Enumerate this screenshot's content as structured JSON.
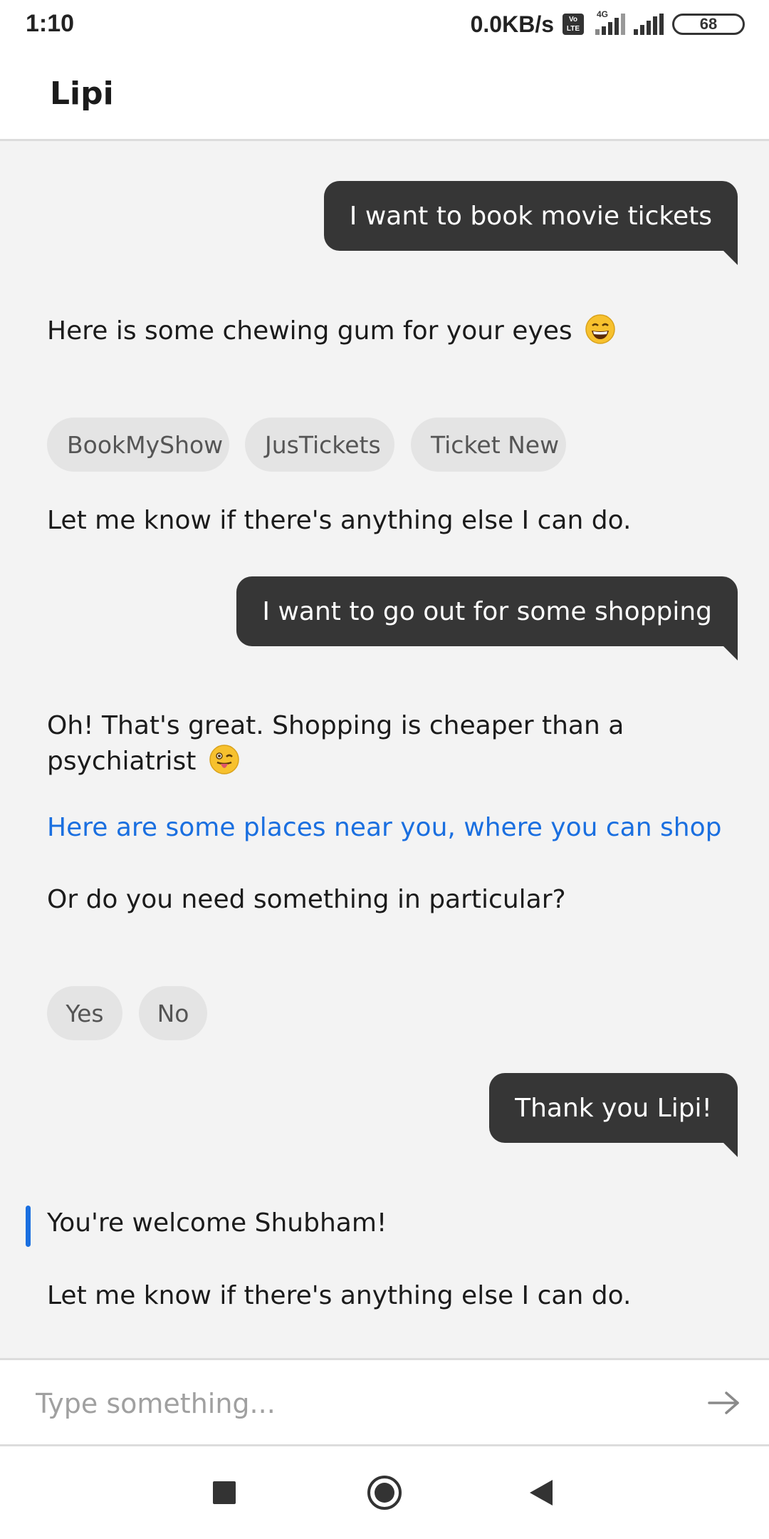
{
  "status_bar": {
    "time": "1:10",
    "net_speed": "0.0KB/s",
    "volte_top": "Vo",
    "volte_bottom": "LTE",
    "network_type": "4G",
    "battery": "68"
  },
  "app_bar": {
    "title": "Lipi"
  },
  "messages": [
    {
      "from": "user",
      "text": "I want to book movie tickets"
    },
    {
      "from": "bot",
      "text": "Here is some chewing gum for your eyes",
      "emoji_icon": "grinning-face-emoji"
    },
    {
      "from": "bot",
      "chips": [
        "BookMyShow",
        "JusTickets",
        "Ticket New"
      ]
    },
    {
      "from": "bot",
      "text": "Let me know if there's anything else I can do."
    },
    {
      "from": "user",
      "text": "I want to go out for some shopping"
    },
    {
      "from": "bot",
      "text_line1": "Oh! That's great. Shopping is cheaper than a",
      "text_line2": "psychiatrist",
      "emoji_icon": "winking-tongue-emoji"
    },
    {
      "from": "bot",
      "link_text": "Here are some places near you, where you can shop"
    },
    {
      "from": "bot",
      "text": "Or do you need something in particular?"
    },
    {
      "from": "bot",
      "chips": [
        "Yes",
        "No"
      ]
    },
    {
      "from": "user",
      "text": "Thank you Lipi!"
    },
    {
      "from": "bot",
      "text": "You're welcome Shubham!"
    },
    {
      "from": "bot",
      "text": "Let me know if there's anything else I can do."
    }
  ],
  "input": {
    "placeholder": "Type something...",
    "value": "",
    "send_icon": "arrow-right-icon"
  },
  "nav_bar": {
    "icons": [
      "recents-square-icon",
      "home-circle-icon",
      "back-triangle-icon"
    ]
  },
  "colors": {
    "user_bubble": "#363636",
    "link": "#1a6fe0",
    "chip_bg": "#e4e4e4",
    "background": "#f3f3f3"
  }
}
